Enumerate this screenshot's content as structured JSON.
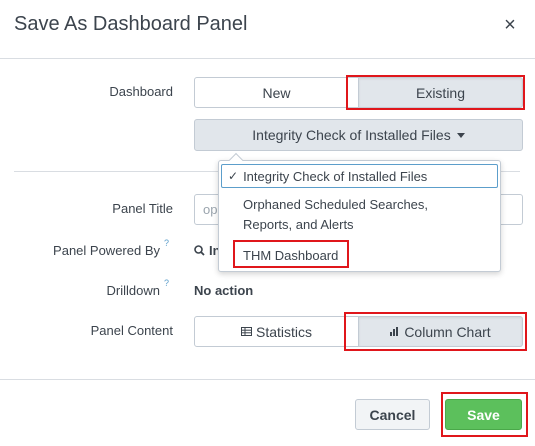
{
  "dialog": {
    "title": "Save As Dashboard Panel",
    "close_label": "×"
  },
  "form": {
    "dashboard_label": "Dashboard",
    "dashboard_options": {
      "new": "New",
      "existing": "Existing"
    },
    "dashboard_selected": "Existing",
    "dashboard_dropdown_value": "Integrity Check of Installed Files",
    "panel_title_label": "Panel Title",
    "panel_title_placeholder": "op",
    "panel_powered_label": "Panel Powered By",
    "panel_powered_help": "?",
    "panel_powered_value": "In",
    "drilldown_label": "Drilldown",
    "drilldown_help": "?",
    "drilldown_value": "No action",
    "panel_content_label": "Panel Content",
    "panel_content_options": {
      "statistics": "Statistics",
      "column_chart": "Column Chart"
    },
    "panel_content_selected": "Column Chart"
  },
  "dropdown_menu": {
    "items": [
      {
        "label": "Integrity Check of Installed Files",
        "selected": true
      },
      {
        "label": "Orphaned Scheduled Searches, Reports, and Alerts",
        "line1": "Orphaned Scheduled Searches,",
        "line2": "Reports, and Alerts",
        "selected": false
      },
      {
        "label": "THM Dashboard",
        "selected": false
      }
    ],
    "check_glyph": "✓"
  },
  "footer": {
    "cancel_label": "Cancel",
    "save_label": "Save"
  },
  "colors": {
    "highlight": "#e0161b",
    "save_button": "#5cc05c",
    "help_icon": "#5c9ecb"
  }
}
